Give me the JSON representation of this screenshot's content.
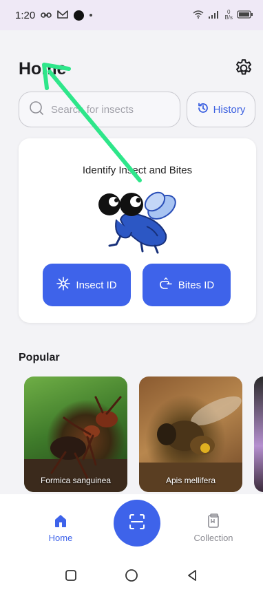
{
  "status_bar": {
    "time": "1:20",
    "net_speed_value": "0",
    "net_speed_unit": "B/s"
  },
  "header": {
    "title": "Home",
    "settings_icon": "gear-icon"
  },
  "search": {
    "placeholder": "Search for insects",
    "value": ""
  },
  "history_button": {
    "label": "History",
    "icon": "clock-history-icon"
  },
  "identify_card": {
    "title": "Identify Insect and Bites",
    "insect_button": {
      "label": "Insect ID",
      "icon": "sparkle-icon"
    },
    "bites_button": {
      "label": "Bites ID",
      "icon": "pointing-hand-icon"
    }
  },
  "popular": {
    "title": "Popular",
    "items": [
      {
        "name": "Formica sanguinea"
      },
      {
        "name": "Apis mellifera"
      }
    ]
  },
  "bottom_nav": {
    "home_label": "Home",
    "collection_label": "Collection",
    "scan_icon": "scan-icon"
  },
  "colors": {
    "accent": "#3e63ea",
    "annotation_arrow": "#2ee68a",
    "background": "#f3f3f6"
  }
}
